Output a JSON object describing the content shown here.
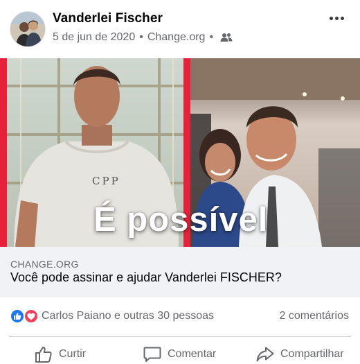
{
  "post": {
    "author": "Vanderlei Fischer",
    "date": "5 de jun de 2020",
    "separator": "•",
    "source": "Change.org",
    "audience_icon": "friends-icon",
    "more_icon": "more-options-icon"
  },
  "image": {
    "overlay_text": "É possível"
  },
  "link": {
    "domain": "CHANGE.ORG",
    "title": "Você pode assinar e ajudar Vanderlei FISCHER?"
  },
  "reactions": {
    "icons": [
      "like-reaction-icon",
      "love-reaction-icon"
    ],
    "summary": "Carlos Paiano e outras 30 pessoas",
    "comments": "2 comentários"
  },
  "actions": {
    "like": "Curtir",
    "comment": "Comentar",
    "share": "Compartilhar"
  },
  "colors": {
    "like_blue": "#1877f2",
    "love_red": "#f33e58",
    "secondary_text": "#65676b",
    "preview_bg": "#f0f2f5",
    "frame_red": "#e8213a"
  }
}
